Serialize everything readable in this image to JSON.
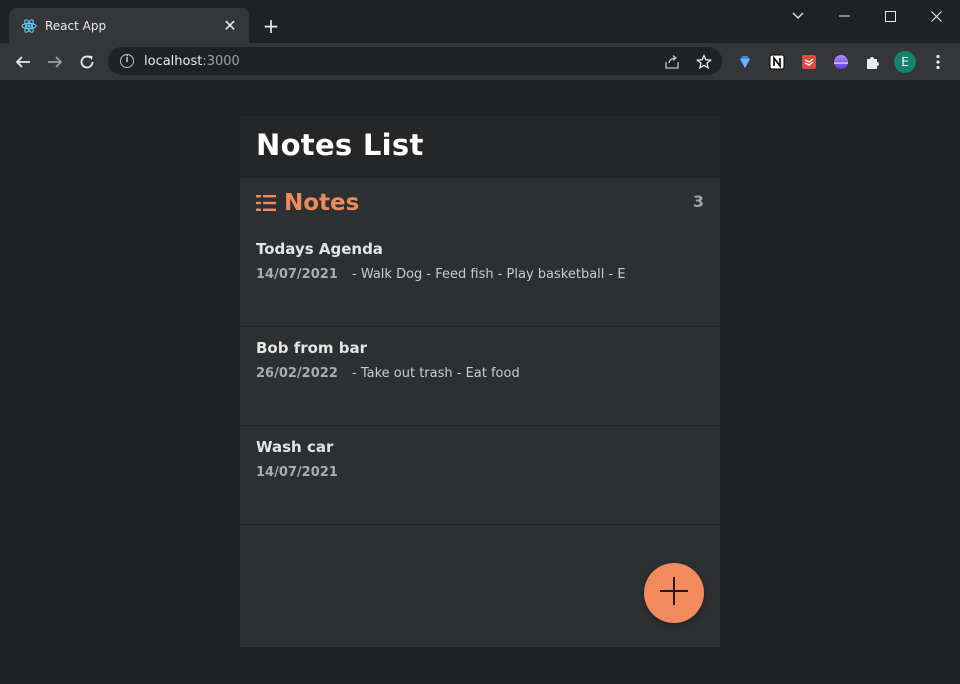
{
  "browser": {
    "tab_title": "React App",
    "tab_close": "✕",
    "new_tab": "+",
    "url_host": "localhost",
    "url_port": ":3000",
    "avatar_letter": "E"
  },
  "app": {
    "title": "Notes List",
    "section_title": "Notes",
    "count": "3",
    "accent_color": "#f08a5d",
    "notes": [
      {
        "title": "Todays Agenda",
        "date": "14/07/2021",
        "preview": "- Walk Dog - Feed fish - Play basketball - E"
      },
      {
        "title": "Bob from bar",
        "date": "26/02/2022",
        "preview": "- Take out trash - Eat food"
      },
      {
        "title": "Wash car",
        "date": "14/07/2021",
        "preview": ""
      }
    ],
    "fab_icon": "plus-icon"
  }
}
